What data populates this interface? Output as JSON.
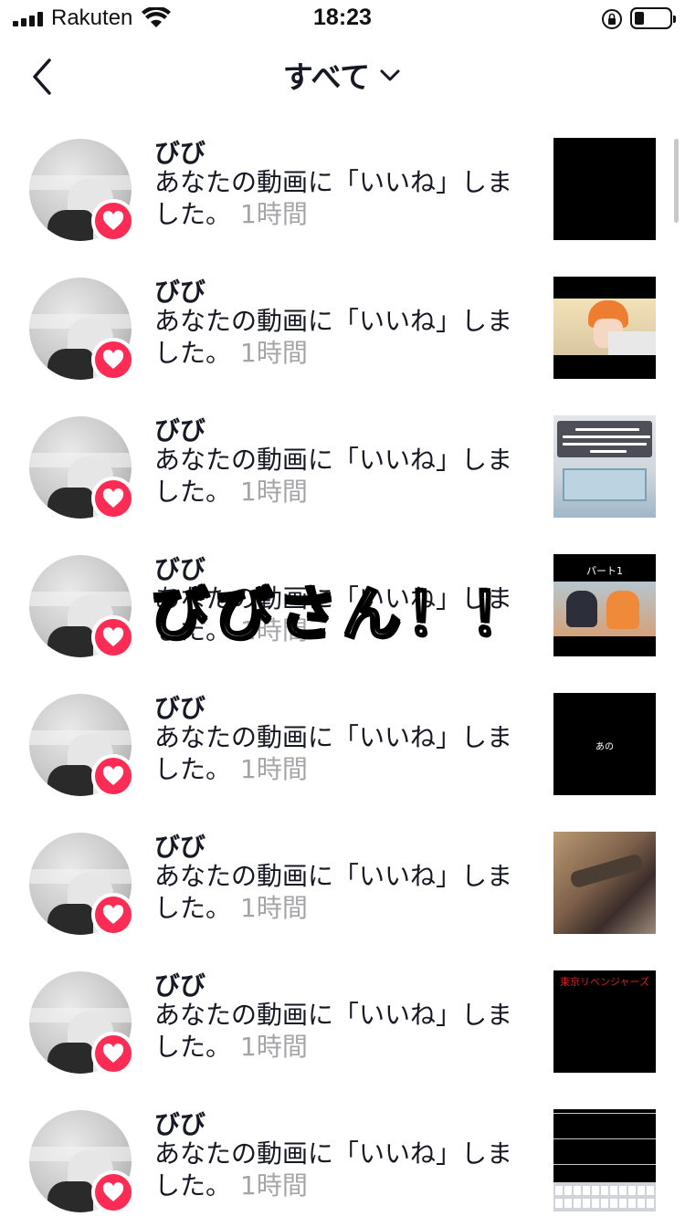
{
  "status_bar": {
    "carrier": "Rakuten",
    "time": "18:23"
  },
  "nav": {
    "title": "すべて"
  },
  "notifications": [
    {
      "username": "びび",
      "message": "あなたの動画に「いいね」しました。",
      "time": "1時間",
      "thumb": "black"
    },
    {
      "username": "びび",
      "message": "あなたの動画に「いいね」しました。",
      "time": "1時間",
      "thumb": "anime-orange-hair"
    },
    {
      "username": "びび",
      "message": "あなたの動画に「いいね」しました。",
      "time": "1時間",
      "thumb": "school-caption"
    },
    {
      "username": "びび",
      "message": "あなたの動画に「いいね」しました。",
      "time": "1時間",
      "thumb": "anime-part1"
    },
    {
      "username": "びび",
      "message": "あなたの動画に「いいね」しました。",
      "time": "1時間",
      "thumb": "black-text"
    },
    {
      "username": "びび",
      "message": "あなたの動画に「いいね」しました。",
      "time": "1時間",
      "thumb": "anime-fight"
    },
    {
      "username": "びび",
      "message": "あなたの動画に「いいね」しました。",
      "time": "1時間",
      "thumb": "black-red-title"
    },
    {
      "username": "びび",
      "message": "あなたの動画に「いいね」しました。",
      "time": "1時間",
      "thumb": "keyboard-screenshot"
    }
  ],
  "thumb_texts": {
    "manga_title": "パート1",
    "black_text": "あの",
    "red_title": "東京リベンジャーズ"
  },
  "overlay": {
    "text": "びびさん！！"
  },
  "colors": {
    "like_badge": "#fe2c55",
    "time_gray": "#a5a5a9",
    "text_primary": "#161823"
  }
}
